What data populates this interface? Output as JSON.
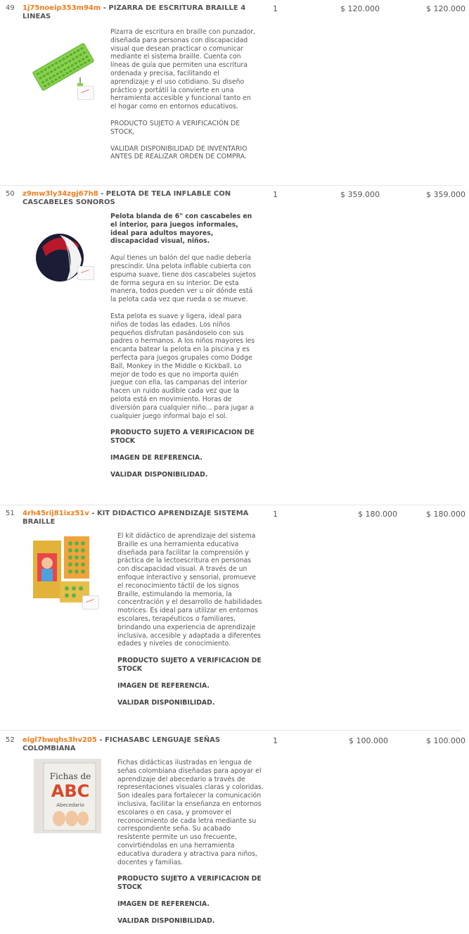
{
  "items": [
    {
      "number": "49",
      "code": "1j75noeip353m94m",
      "title": "PIZARRA DE ESCRITURA BRAILLE 4 LINEAS",
      "qty": "1",
      "unit_price": "$ 120.000",
      "total": "$ 120.000",
      "paragraphs": [
        "Pizarra de escritura en braille con punzador, diseñada para personas con discapacidad visual que desean practicar o comunicar mediante el sistema braille. Cuenta con líneas de guía que permiten una escritura ordenada y precisa, facilitando el aprendizaje y el uso cotidiano. Su diseño práctico y portátil la convierte en una herramienta accesible y funcional tanto en el hogar como en entornos educativos.",
        "PRODUCTO SUJETO A VERIFICACIÓN DE STOCK,",
        "VALIDAR DISPONIBILIDAD DE INVENTARIO ANTES DE REALIZAR ORDEN DE COMPRA."
      ]
    },
    {
      "number": "50",
      "code": "z9mw3ly34zgj67h8",
      "title": "PELOTA DE TELA INFLABLE CON CASCABELES SONOROS",
      "qty": "1",
      "unit_price": "$ 359.000",
      "total": "$ 359.000",
      "lead": "Pelota blanda de 6\" con cascabeles en el interior, para juegos informales, ideal para adultos mayores, discapacidad visual, niños.",
      "paragraphs": [
        "Aquí tienes un balón del que nadie debería prescindir. Una pelota inflable cubierta con espuma suave, tiene dos cascabeles sujetos de forma segura en su interior. De esta manera, todos pueden ver u oír dónde está la pelota cada vez que rueda o se mueve.",
        "Esta pelota es suave y ligera, ideal para niños de todas las edades. Los niños pequeños disfrutan pasándoselo con sus padres o hermanos. A los niños mayores les encanta batear la pelota en la piscina y es perfecta para juegos grupales como Dodge Ball, Monkey in the Middle o Kickball. Lo mejor de todo es que no importa quién juegue con ella, las campanas del interior hacen un ruido audible cada vez que la pelota está en movimiento. Horas de diversión para cualquier niño... para jugar a cualquier juego informal bajo el sol."
      ],
      "notes": [
        "PRODUCTO SUJETO A VERIFICACION DE STOCK",
        "IMAGEN DE REFERENCIA.",
        "VALIDAR DISPONIBILIDAD."
      ]
    },
    {
      "number": "51",
      "code": "4rh45rij81ixz51v",
      "title": "KIT DIDACTICO APRENDIZAJE SISTEMA BRAILLE",
      "qty": "1",
      "unit_price": "$ 180.000",
      "total": "$ 180.000",
      "paragraphs": [
        "El kit didáctico de aprendizaje del sistema Braille es una herramienta educativa diseñada para facilitar la comprensión y práctica de la lectoescritura en personas con discapacidad visual. A través de un enfoque interactivo y sensorial, promueve el reconocimiento táctil de los signos Braille, estimulando la memoria, la concentración y el desarrollo de habilidades motrices. Es ideal para utilizar en entornos escolares, terapéuticos o familiares, brindando una experiencia de aprendizaje inclusiva, accesible y adaptada a diferentes edades y niveles de conocimiento."
      ],
      "notes": [
        "PRODUCTO SUJETO A VERIFICACION DE STOCK",
        "IMAGEN DE REFERENCIA.",
        "VALIDAR DISPONIBILIDAD."
      ]
    },
    {
      "number": "52",
      "code": "eigl7bwqhs3hv205",
      "title": "FICHASABC LENGUAJE SEÑAS COLOMBIANA",
      "qty": "1",
      "unit_price": "$ 100.000",
      "total": "$ 100.000",
      "image_text": {
        "line1": "Fichas de",
        "line2": "ABC",
        "line3": "Abecedario"
      },
      "paragraphs": [
        "Fichas didácticas ilustradas en lengua de señas colombiana diseñadas para apoyar el aprendizaje del abecedario a través de representaciones visuales claras y coloridas. Son ideales para fortalecer la comunicación inclusiva, facilitar la enseñanza en entornos escolares o en casa, y promover el reconocimiento de cada letra mediante su correspondiente seña. Su acabado resistente permite un uso frecuente, convirtiéndolas en una herramienta educativa duradera y atractiva para niños, docentes y familias."
      ],
      "notes": [
        "PRODUCTO SUJETO A VERIFICACION DE STOCK",
        "IMAGEN DE REFERENCIA.",
        "VALIDAR DISPONIBILIDAD."
      ]
    }
  ],
  "colors": {
    "code": "#f07c1c",
    "text": "#555555",
    "divider": "#e6e6e6"
  }
}
